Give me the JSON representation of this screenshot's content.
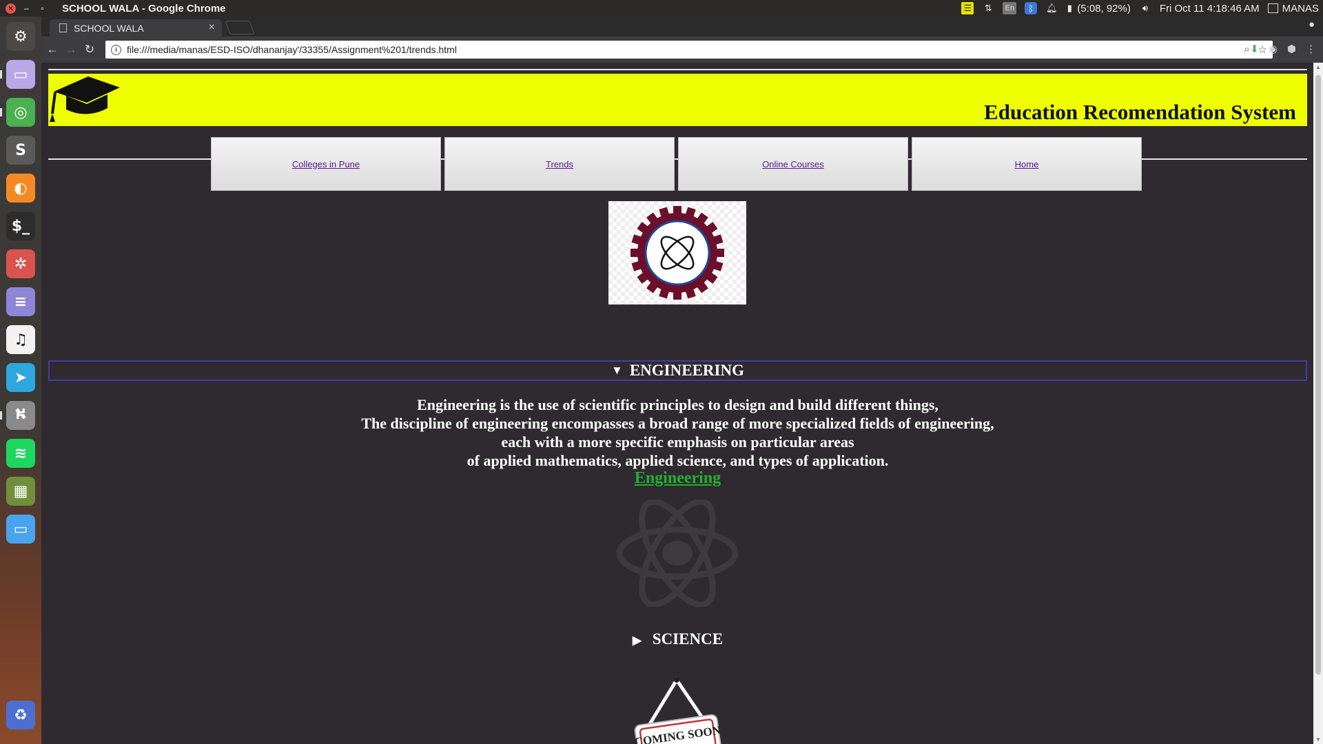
{
  "os": {
    "window_title": "SCHOOL WALA - Google Chrome",
    "tray": {
      "keyboard": "En",
      "battery": "(5:08, 92%)",
      "datetime": "Fri Oct 11  4:18:46 AM",
      "user": "MANAS"
    },
    "launcher": [
      {
        "name": "ubuntu-dash-icon",
        "color": "#4b4846"
      },
      {
        "name": "files-icon",
        "color": "#b9a8e6"
      },
      {
        "name": "chrome-icon",
        "color": "#4caf50"
      },
      {
        "name": "sublime-text-icon",
        "color": "#5a5a5a"
      },
      {
        "name": "firefox-icon",
        "color": "#f58a24"
      },
      {
        "name": "terminal-icon",
        "color": "#2d2d2d"
      },
      {
        "name": "app-center-icon",
        "color": "#d9534f"
      },
      {
        "name": "text-editor-icon",
        "color": "#8e86d6"
      },
      {
        "name": "music-icon",
        "color": "#f2f2f2"
      },
      {
        "name": "telegram-icon",
        "color": "#2ea6de"
      },
      {
        "name": "usb-icon",
        "color": "#8a8a8a"
      },
      {
        "name": "spotify-icon",
        "color": "#1ed760"
      },
      {
        "name": "minecraft-icon",
        "color": "#6f8f3d"
      },
      {
        "name": "folder-icon",
        "color": "#4aa3ee"
      }
    ]
  },
  "browser": {
    "tab_title": "SCHOOL WALA",
    "url": "file:///media/manas/ESD-ISO/dhananjay'/33355/Assignment%201/trends.html"
  },
  "page": {
    "site_title": "Education Recomendation System",
    "nav": [
      {
        "label": "Colleges in Pune"
      },
      {
        "label": "Trends"
      },
      {
        "label": "Online Courses"
      },
      {
        "label": "Home"
      }
    ],
    "engineering": {
      "summary": "ENGINEERING",
      "lines": [
        "Engineering is the use of scientific principles to design and build different things,",
        "The discipline of engineering encompasses a broad range of more specialized fields of engineering,",
        "each with a more specific emphasis on particular areas",
        "of applied mathematics, applied science, and types of application."
      ],
      "link": "Engineering"
    },
    "science": {
      "summary": "SCIENCE"
    },
    "coming_soon_text": "COMING SOON",
    "colors": {
      "banner": "#eeff00",
      "background": "#2f2a30",
      "link_green": "#1db42c",
      "gear": "#6b0f2a"
    }
  }
}
